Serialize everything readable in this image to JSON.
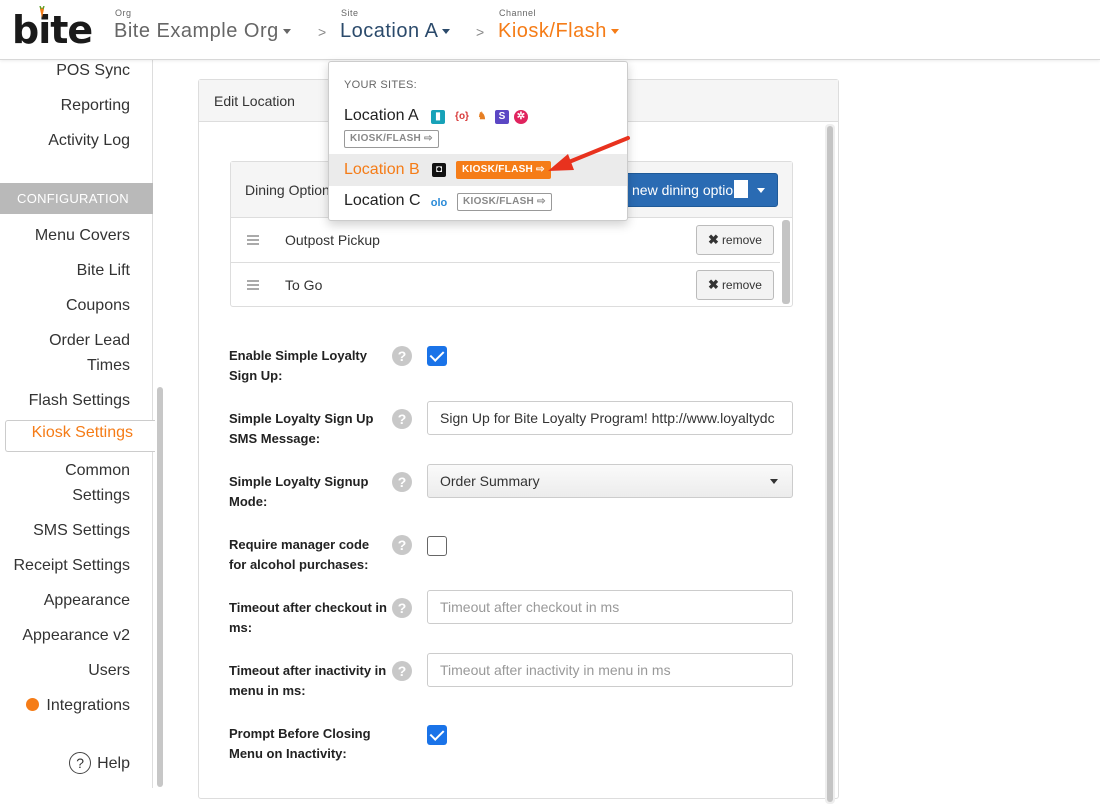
{
  "header": {
    "logo_text": "bite",
    "org": {
      "caption": "Org",
      "value": "Bite Example Org"
    },
    "site": {
      "caption": "Site",
      "value": "Location A"
    },
    "channel": {
      "caption": "Channel",
      "value": "Kiosk/Flash"
    },
    "separator": ">"
  },
  "sidebar": {
    "items_top": [
      "POS Sync",
      "Reporting",
      "Activity Log"
    ],
    "section_label": "CONFIGURATION",
    "items": [
      "Menu Covers",
      "Bite Lift",
      "Coupons",
      "Order Lead",
      "Times",
      "Flash Settings",
      "Kiosk Settings",
      "Common",
      "Settings",
      "SMS Settings",
      "Receipt Settings",
      "Appearance",
      "Appearance v2",
      "Users",
      "Integrations"
    ],
    "active": "Kiosk Settings",
    "help": {
      "icon": "?",
      "label": "Help"
    }
  },
  "panel": {
    "title": "Edit Location",
    "dining": {
      "title": "Dining Options",
      "add_button": "new dining optio",
      "rows": [
        {
          "name": "Outpost Pickup",
          "action": "remove",
          "action_icon": "✖"
        },
        {
          "name": "To Go",
          "action": "remove",
          "action_icon": "✖"
        }
      ]
    },
    "fields": {
      "loyalty_enable": {
        "label": "Enable Simple Loyalty Sign Up:",
        "checked": true
      },
      "loyalty_sms": {
        "label": "Simple Loyalty Sign Up SMS Message:",
        "value": "Sign Up for Bite Loyalty Program! http://www.loyaltydc"
      },
      "loyalty_mode": {
        "label": "Simple Loyalty Signup Mode:",
        "value": "Order Summary"
      },
      "manager_code": {
        "label": "Require manager code for alcohol purchases:",
        "checked": false
      },
      "timeout_checkout": {
        "label": "Timeout after checkout in ms:",
        "placeholder": "Timeout after checkout in ms"
      },
      "timeout_inactivity": {
        "label": "Timeout after inactivity in menu in ms:",
        "placeholder": "Timeout after inactivity in menu in ms"
      },
      "prompt_closing": {
        "label": "Prompt Before Closing Menu on Inactivity:",
        "checked": true
      }
    },
    "help_icon": "?"
  },
  "dropdown": {
    "caption": "YOUR SITES:",
    "sites": [
      {
        "name": "Location A",
        "channel": "KIOSK/FLASH ⇨",
        "highlighted": false
      },
      {
        "name": "Location B",
        "channel": "KIOSK/FLASH ⇨",
        "highlighted": true
      },
      {
        "name": "Location C",
        "channel": "KIOSK/FLASH ⇨",
        "highlighted": false
      }
    ],
    "olo_text": "olo"
  },
  "colors": {
    "brand_orange": "#f57c17",
    "primary_blue": "#2a6bb3",
    "site_blue": "#2b4a6b",
    "checkbox_blue": "#1a73e8",
    "arrow_red": "#e8321e"
  },
  "icons": [
    "caret-down-icon",
    "drag-handle-icon",
    "remove-x-icon",
    "help-question-icon",
    "checkbox-icon",
    "arrow-icon",
    "pos-integration-icons"
  ]
}
